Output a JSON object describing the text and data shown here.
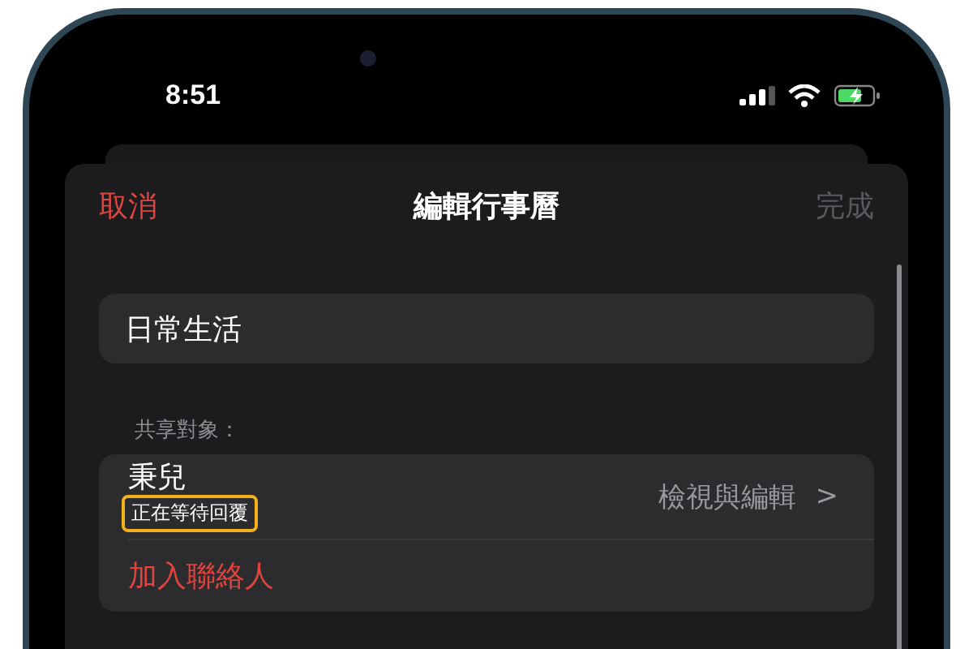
{
  "status_bar": {
    "time": "8:51"
  },
  "nav": {
    "cancel": "取消",
    "title": "編輯行事曆",
    "done": {
      "label": "完成",
      "disabled": true
    }
  },
  "calendar_name": {
    "value": "日常生活"
  },
  "shared_with": {
    "header": "共享對象：",
    "people": [
      {
        "name": "秉兒",
        "status": "正在等待回覆",
        "highlighted": true,
        "permission": "檢視與編輯",
        "chevron": ">"
      }
    ],
    "add_contact": "加入聯絡人"
  }
}
